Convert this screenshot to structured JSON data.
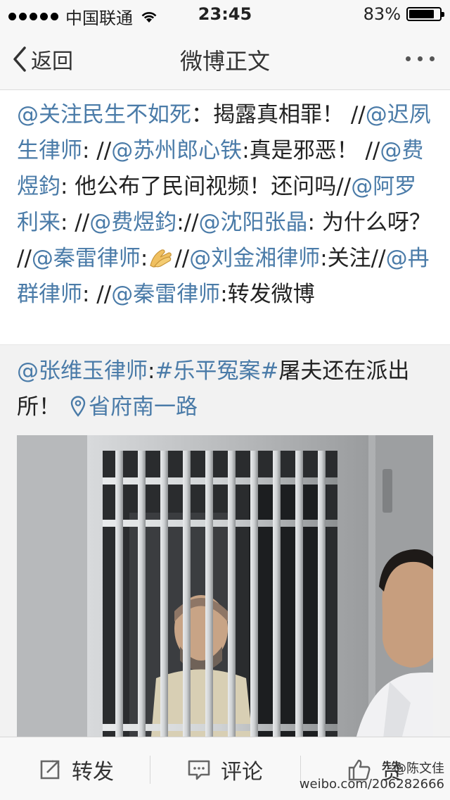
{
  "status_bar": {
    "carrier": "中国联通",
    "time": "23:45",
    "battery_percent": "83%",
    "battery_level": 0.83,
    "signal_bars": 5,
    "icons": [
      "signal-dots-icon",
      "wifi-icon",
      "battery-icon"
    ]
  },
  "nav": {
    "back_label": "返回",
    "title": "微博正文",
    "icons": [
      "chevron-left-icon",
      "more-icon"
    ]
  },
  "repost": {
    "segments": [
      {
        "t": "@关注民生不如死",
        "mention": true
      },
      {
        "t": "：揭露真相罪！ //",
        "mention": false
      },
      {
        "t": "@迟夙生律师",
        "mention": true
      },
      {
        "t": ": //",
        "mention": false
      },
      {
        "t": "@苏州郎心铁",
        "mention": true
      },
      {
        "t": ":真是邪恶！ //",
        "mention": false
      },
      {
        "t": "@费煜鈞",
        "mention": true
      },
      {
        "t": ": 他公布了民间视频！还问吗//",
        "mention": false
      },
      {
        "t": "@阿罗利来",
        "mention": true
      },
      {
        "t": ": //",
        "mention": false
      },
      {
        "t": "@费煜鈞",
        "mention": true
      },
      {
        "t": "://",
        "mention": false
      },
      {
        "t": "@沈阳张晶",
        "mention": true
      },
      {
        "t": ": 为什么呀？ //",
        "mention": false
      },
      {
        "t": "@秦雷律师",
        "mention": true
      },
      {
        "t": ":",
        "mention": false
      },
      {
        "t": "[emoji]",
        "emoji": true
      },
      {
        "t": "//",
        "mention": false
      },
      {
        "t": "@刘金湘律师",
        "mention": true
      },
      {
        "t": ":关注//",
        "mention": false
      },
      {
        "t": "@冉群律师",
        "mention": true
      },
      {
        "t": ": //",
        "mention": false
      },
      {
        "t": "@秦雷律师",
        "mention": true
      },
      {
        "t": ":转发微博",
        "mention": false
      }
    ],
    "emoji_icon": "praying-hands-icon"
  },
  "original": {
    "author": "@张维玉律师",
    "separator": ":",
    "topic": "#乐平冤案#",
    "text": "屠夫还在派出所！",
    "location": "省府南一路",
    "location_icon": "location-pin-icon"
  },
  "toolbar": {
    "repost_label": "转发",
    "comment_label": "评论",
    "like_label": "赞",
    "icons": [
      "repost-icon",
      "comment-icon",
      "thumbs-up-icon"
    ]
  },
  "watermark": {
    "line1": "@陈文佳",
    "line2": "weibo.com/206282666"
  },
  "colors": {
    "mention": "#4a7ba8",
    "text": "#222222",
    "nav_bg": "#f7f7f7"
  }
}
